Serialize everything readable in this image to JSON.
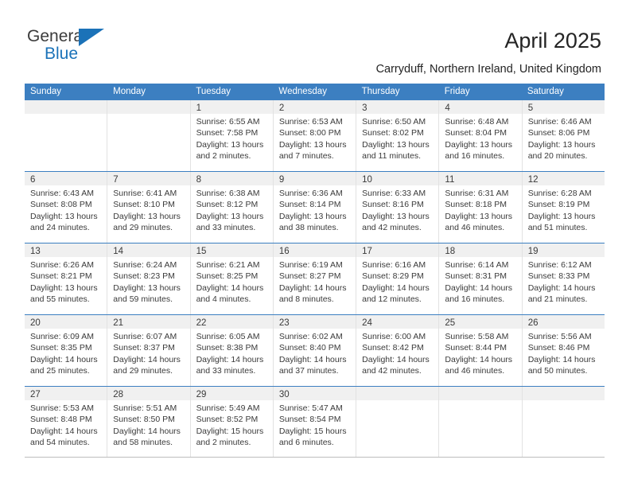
{
  "brand": {
    "name_top": "General",
    "name_bottom": "Blue",
    "accent_color": "#1b72b8",
    "triangle_icon": "brand-triangle-icon"
  },
  "header": {
    "title": "April 2025",
    "subtitle": "Carryduff, Northern Ireland, United Kingdom"
  },
  "theme": {
    "header_row_bg": "#3c7fc1",
    "header_row_text": "#ffffff",
    "week_divider": "#3c7fc1",
    "daynum_band_bg": "#f0f0f0",
    "cell_bg": "#ffffff",
    "text": "#3a3a3a"
  },
  "weekdays": [
    "Sunday",
    "Monday",
    "Tuesday",
    "Wednesday",
    "Thursday",
    "Friday",
    "Saturday"
  ],
  "weeks": [
    [
      {
        "empty": true
      },
      {
        "empty": true
      },
      {
        "day": "1",
        "sunrise": "Sunrise: 6:55 AM",
        "sunset": "Sunset: 7:58 PM",
        "daylight": "Daylight: 13 hours and 2 minutes."
      },
      {
        "day": "2",
        "sunrise": "Sunrise: 6:53 AM",
        "sunset": "Sunset: 8:00 PM",
        "daylight": "Daylight: 13 hours and 7 minutes."
      },
      {
        "day": "3",
        "sunrise": "Sunrise: 6:50 AM",
        "sunset": "Sunset: 8:02 PM",
        "daylight": "Daylight: 13 hours and 11 minutes."
      },
      {
        "day": "4",
        "sunrise": "Sunrise: 6:48 AM",
        "sunset": "Sunset: 8:04 PM",
        "daylight": "Daylight: 13 hours and 16 minutes."
      },
      {
        "day": "5",
        "sunrise": "Sunrise: 6:46 AM",
        "sunset": "Sunset: 8:06 PM",
        "daylight": "Daylight: 13 hours and 20 minutes."
      }
    ],
    [
      {
        "day": "6",
        "sunrise": "Sunrise: 6:43 AM",
        "sunset": "Sunset: 8:08 PM",
        "daylight": "Daylight: 13 hours and 24 minutes."
      },
      {
        "day": "7",
        "sunrise": "Sunrise: 6:41 AM",
        "sunset": "Sunset: 8:10 PM",
        "daylight": "Daylight: 13 hours and 29 minutes."
      },
      {
        "day": "8",
        "sunrise": "Sunrise: 6:38 AM",
        "sunset": "Sunset: 8:12 PM",
        "daylight": "Daylight: 13 hours and 33 minutes."
      },
      {
        "day": "9",
        "sunrise": "Sunrise: 6:36 AM",
        "sunset": "Sunset: 8:14 PM",
        "daylight": "Daylight: 13 hours and 38 minutes."
      },
      {
        "day": "10",
        "sunrise": "Sunrise: 6:33 AM",
        "sunset": "Sunset: 8:16 PM",
        "daylight": "Daylight: 13 hours and 42 minutes."
      },
      {
        "day": "11",
        "sunrise": "Sunrise: 6:31 AM",
        "sunset": "Sunset: 8:18 PM",
        "daylight": "Daylight: 13 hours and 46 minutes."
      },
      {
        "day": "12",
        "sunrise": "Sunrise: 6:28 AM",
        "sunset": "Sunset: 8:19 PM",
        "daylight": "Daylight: 13 hours and 51 minutes."
      }
    ],
    [
      {
        "day": "13",
        "sunrise": "Sunrise: 6:26 AM",
        "sunset": "Sunset: 8:21 PM",
        "daylight": "Daylight: 13 hours and 55 minutes."
      },
      {
        "day": "14",
        "sunrise": "Sunrise: 6:24 AM",
        "sunset": "Sunset: 8:23 PM",
        "daylight": "Daylight: 13 hours and 59 minutes."
      },
      {
        "day": "15",
        "sunrise": "Sunrise: 6:21 AM",
        "sunset": "Sunset: 8:25 PM",
        "daylight": "Daylight: 14 hours and 4 minutes."
      },
      {
        "day": "16",
        "sunrise": "Sunrise: 6:19 AM",
        "sunset": "Sunset: 8:27 PM",
        "daylight": "Daylight: 14 hours and 8 minutes."
      },
      {
        "day": "17",
        "sunrise": "Sunrise: 6:16 AM",
        "sunset": "Sunset: 8:29 PM",
        "daylight": "Daylight: 14 hours and 12 minutes."
      },
      {
        "day": "18",
        "sunrise": "Sunrise: 6:14 AM",
        "sunset": "Sunset: 8:31 PM",
        "daylight": "Daylight: 14 hours and 16 minutes."
      },
      {
        "day": "19",
        "sunrise": "Sunrise: 6:12 AM",
        "sunset": "Sunset: 8:33 PM",
        "daylight": "Daylight: 14 hours and 21 minutes."
      }
    ],
    [
      {
        "day": "20",
        "sunrise": "Sunrise: 6:09 AM",
        "sunset": "Sunset: 8:35 PM",
        "daylight": "Daylight: 14 hours and 25 minutes."
      },
      {
        "day": "21",
        "sunrise": "Sunrise: 6:07 AM",
        "sunset": "Sunset: 8:37 PM",
        "daylight": "Daylight: 14 hours and 29 minutes."
      },
      {
        "day": "22",
        "sunrise": "Sunrise: 6:05 AM",
        "sunset": "Sunset: 8:38 PM",
        "daylight": "Daylight: 14 hours and 33 minutes."
      },
      {
        "day": "23",
        "sunrise": "Sunrise: 6:02 AM",
        "sunset": "Sunset: 8:40 PM",
        "daylight": "Daylight: 14 hours and 37 minutes."
      },
      {
        "day": "24",
        "sunrise": "Sunrise: 6:00 AM",
        "sunset": "Sunset: 8:42 PM",
        "daylight": "Daylight: 14 hours and 42 minutes."
      },
      {
        "day": "25",
        "sunrise": "Sunrise: 5:58 AM",
        "sunset": "Sunset: 8:44 PM",
        "daylight": "Daylight: 14 hours and 46 minutes."
      },
      {
        "day": "26",
        "sunrise": "Sunrise: 5:56 AM",
        "sunset": "Sunset: 8:46 PM",
        "daylight": "Daylight: 14 hours and 50 minutes."
      }
    ],
    [
      {
        "day": "27",
        "sunrise": "Sunrise: 5:53 AM",
        "sunset": "Sunset: 8:48 PM",
        "daylight": "Daylight: 14 hours and 54 minutes."
      },
      {
        "day": "28",
        "sunrise": "Sunrise: 5:51 AM",
        "sunset": "Sunset: 8:50 PM",
        "daylight": "Daylight: 14 hours and 58 minutes."
      },
      {
        "day": "29",
        "sunrise": "Sunrise: 5:49 AM",
        "sunset": "Sunset: 8:52 PM",
        "daylight": "Daylight: 15 hours and 2 minutes."
      },
      {
        "day": "30",
        "sunrise": "Sunrise: 5:47 AM",
        "sunset": "Sunset: 8:54 PM",
        "daylight": "Daylight: 15 hours and 6 minutes."
      },
      {
        "empty": true
      },
      {
        "empty": true
      },
      {
        "empty": true
      }
    ]
  ]
}
